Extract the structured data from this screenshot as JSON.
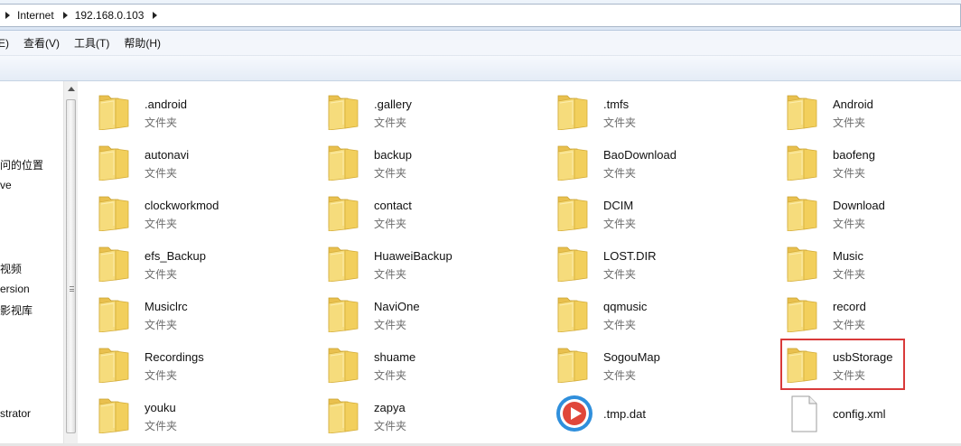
{
  "address": {
    "crumbs": [
      "Internet",
      "192.168.0.103"
    ]
  },
  "menu": {
    "items": [
      "E)",
      "查看(V)",
      "工具(T)",
      "帮助(H)"
    ]
  },
  "nav": {
    "items": [
      "问的位置",
      "ve",
      "视频",
      "ersion",
      "影视库",
      "strator"
    ]
  },
  "files": [
    {
      "name": ".android",
      "type": "文件夹",
      "icon": "folder-icon"
    },
    {
      "name": ".gallery",
      "type": "文件夹",
      "icon": "folder-icon"
    },
    {
      "name": ".tmfs",
      "type": "文件夹",
      "icon": "folder-icon"
    },
    {
      "name": "Android",
      "type": "文件夹",
      "icon": "folder-icon"
    },
    {
      "name": "autonavi",
      "type": "文件夹",
      "icon": "folder-icon"
    },
    {
      "name": "backup",
      "type": "文件夹",
      "icon": "folder-icon"
    },
    {
      "name": "BaoDownload",
      "type": "文件夹",
      "icon": "folder-icon"
    },
    {
      "name": "baofeng",
      "type": "文件夹",
      "icon": "folder-icon"
    },
    {
      "name": "clockworkmod",
      "type": "文件夹",
      "icon": "folder-icon"
    },
    {
      "name": "contact",
      "type": "文件夹",
      "icon": "folder-icon"
    },
    {
      "name": "DCIM",
      "type": "文件夹",
      "icon": "folder-icon"
    },
    {
      "name": "Download",
      "type": "文件夹",
      "icon": "folder-icon"
    },
    {
      "name": "efs_Backup",
      "type": "文件夹",
      "icon": "folder-icon"
    },
    {
      "name": "HuaweiBackup",
      "type": "文件夹",
      "icon": "folder-icon"
    },
    {
      "name": "LOST.DIR",
      "type": "文件夹",
      "icon": "folder-icon"
    },
    {
      "name": "Music",
      "type": "文件夹",
      "icon": "folder-icon"
    },
    {
      "name": "Musiclrc",
      "type": "文件夹",
      "icon": "folder-icon"
    },
    {
      "name": "NaviOne",
      "type": "文件夹",
      "icon": "folder-icon"
    },
    {
      "name": "qqmusic",
      "type": "文件夹",
      "icon": "folder-icon"
    },
    {
      "name": "record",
      "type": "文件夹",
      "icon": "folder-icon"
    },
    {
      "name": "Recordings",
      "type": "文件夹",
      "icon": "folder-icon"
    },
    {
      "name": "shuame",
      "type": "文件夹",
      "icon": "folder-icon"
    },
    {
      "name": "SogouMap",
      "type": "文件夹",
      "icon": "folder-icon"
    },
    {
      "name": "usbStorage",
      "type": "文件夹",
      "icon": "folder-icon"
    },
    {
      "name": "youku",
      "type": "文件夹",
      "icon": "folder-icon"
    },
    {
      "name": "zapya",
      "type": "文件夹",
      "icon": "folder-icon"
    },
    {
      "name": ".tmp.dat",
      "type": "",
      "icon": "media-play-icon"
    },
    {
      "name": "config.xml",
      "type": "",
      "icon": "document-icon"
    }
  ],
  "colors": {
    "folder_front": "#f6dc7c",
    "folder_back": "#e9c04e",
    "highlight": "#d93a3a",
    "media_blue": "#2f8fdc",
    "media_red": "#e0473a"
  }
}
